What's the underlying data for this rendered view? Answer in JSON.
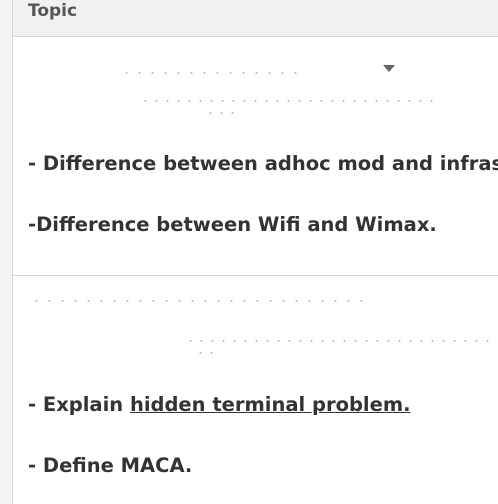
{
  "header": {
    "topic_label": "Topic"
  },
  "section1": {
    "items": [
      {
        "text": "- Difference between adhoc mod and  infrastru"
      },
      {
        "text": "-Difference between Wifi and Wimax."
      }
    ]
  },
  "section2": {
    "item_explain": {
      "prefix": "- Explain ",
      "link": "hidden terminal problem."
    },
    "item_define": {
      "text": "- Define MACA."
    }
  },
  "icons": {
    "dropdown": "chevron-down-icon"
  }
}
